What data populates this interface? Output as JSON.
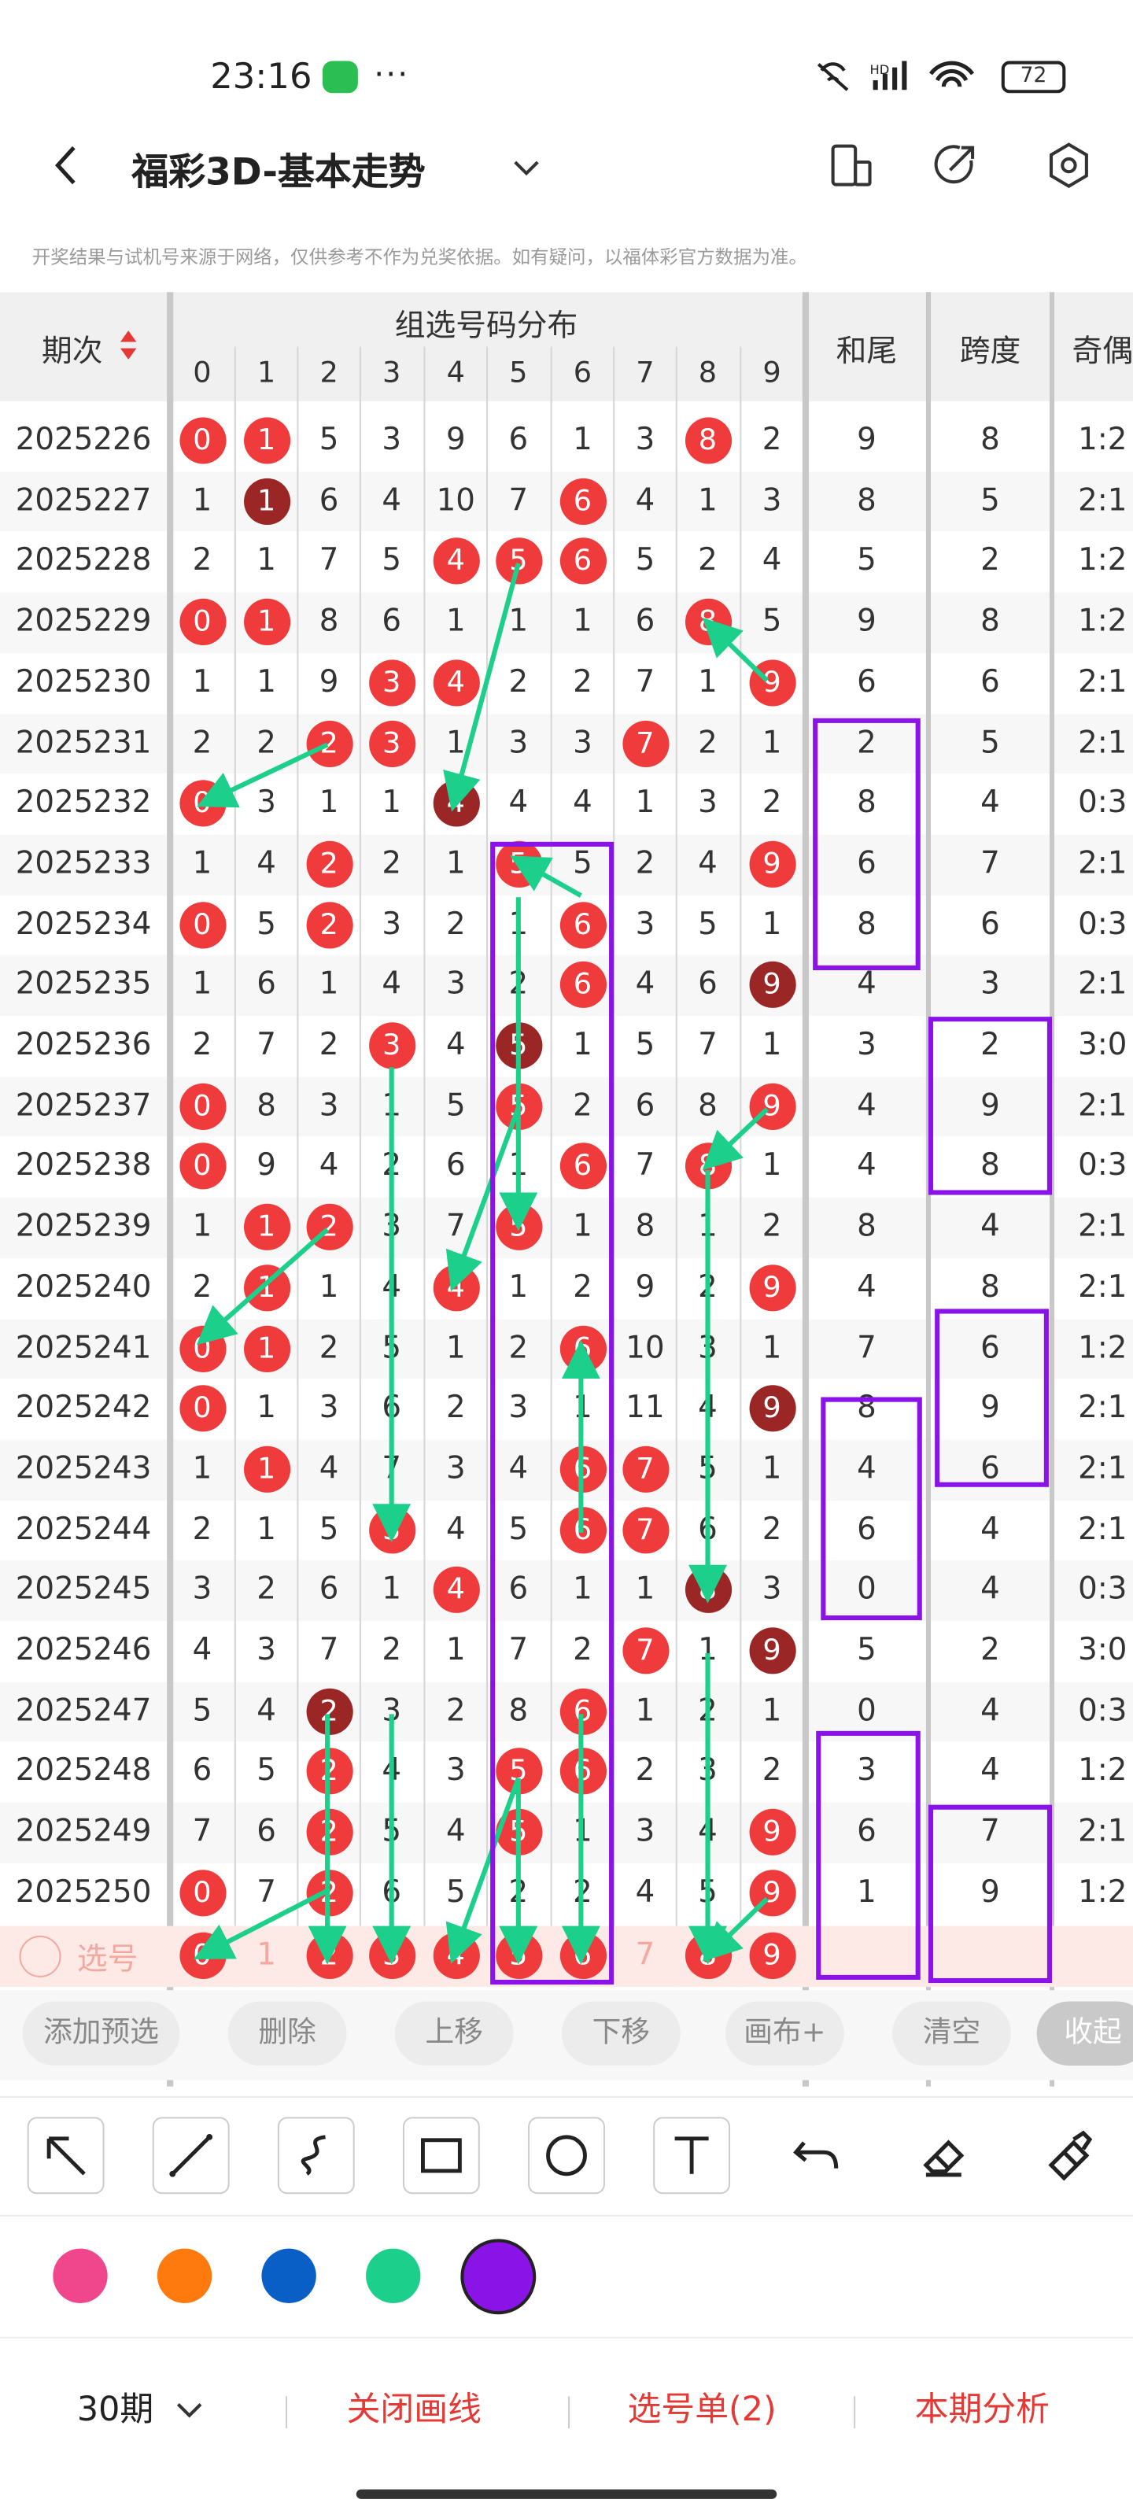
{
  "status_bar": {
    "time": "23:16",
    "more": "···",
    "signal": "HD",
    "battery": "72"
  },
  "nav": {
    "title": "福彩3D-基本走势",
    "back_icon": "chevron-left-icon",
    "dropdown_icon": "chevron-down-icon"
  },
  "notice": "开奖结果与试机号来源于网络，仅供参考不作为兑奖依据。如有疑问，以福体彩官方数据为准。",
  "table": {
    "col_period": "期次",
    "group_header": "组选号码分布",
    "digits": [
      "0",
      "1",
      "2",
      "3",
      "4",
      "5",
      "6",
      "7",
      "8",
      "9"
    ],
    "col_sum_tail": "和尾",
    "col_span": "跨度",
    "col_odd_even": "奇偶",
    "rows": [
      {
        "period": "2025226",
        "cells": [
          "0",
          "1",
          "5",
          "3",
          "9",
          "6",
          "1",
          "3",
          "8",
          "2"
        ],
        "hits": [
          0,
          1,
          8
        ],
        "dark": [],
        "sum_tail": "9",
        "span": "8",
        "odd_even": "1:2"
      },
      {
        "period": "2025227",
        "cells": [
          "1",
          "1",
          "6",
          "4",
          "10",
          "7",
          "6",
          "4",
          "1",
          "3"
        ],
        "hits": [
          1,
          6
        ],
        "dark": [
          1
        ],
        "sum_tail": "8",
        "span": "5",
        "odd_even": "2:1"
      },
      {
        "period": "2025228",
        "cells": [
          "2",
          "1",
          "7",
          "5",
          "4",
          "5",
          "6",
          "5",
          "2",
          "4"
        ],
        "hits": [
          4,
          5,
          6
        ],
        "dark": [],
        "sum_tail": "5",
        "span": "2",
        "odd_even": "1:2"
      },
      {
        "period": "2025229",
        "cells": [
          "0",
          "1",
          "8",
          "6",
          "1",
          "1",
          "1",
          "6",
          "8",
          "5"
        ],
        "hits": [
          0,
          1,
          8
        ],
        "dark": [],
        "sum_tail": "9",
        "span": "8",
        "odd_even": "1:2"
      },
      {
        "period": "2025230",
        "cells": [
          "1",
          "1",
          "9",
          "3",
          "4",
          "2",
          "2",
          "7",
          "1",
          "9"
        ],
        "hits": [
          3,
          4,
          9
        ],
        "dark": [],
        "sum_tail": "6",
        "span": "6",
        "odd_even": "2:1"
      },
      {
        "period": "2025231",
        "cells": [
          "2",
          "2",
          "2",
          "3",
          "1",
          "3",
          "3",
          "7",
          "2",
          "1"
        ],
        "hits": [
          2,
          3,
          7
        ],
        "dark": [],
        "sum_tail": "2",
        "span": "5",
        "odd_even": "2:1"
      },
      {
        "period": "2025232",
        "cells": [
          "0",
          "3",
          "1",
          "1",
          "4",
          "4",
          "4",
          "1",
          "3",
          "2"
        ],
        "hits": [
          0,
          4
        ],
        "dark": [
          4
        ],
        "sum_tail": "8",
        "span": "4",
        "odd_even": "0:3"
      },
      {
        "period": "2025233",
        "cells": [
          "1",
          "4",
          "2",
          "2",
          "1",
          "5",
          "5",
          "2",
          "4",
          "9"
        ],
        "hits": [
          2,
          5,
          9
        ],
        "dark": [],
        "sum_tail": "6",
        "span": "7",
        "odd_even": "2:1"
      },
      {
        "period": "2025234",
        "cells": [
          "0",
          "5",
          "2",
          "3",
          "2",
          "1",
          "6",
          "3",
          "5",
          "1"
        ],
        "hits": [
          0,
          2,
          6
        ],
        "dark": [],
        "sum_tail": "8",
        "span": "6",
        "odd_even": "0:3"
      },
      {
        "period": "2025235",
        "cells": [
          "1",
          "6",
          "1",
          "4",
          "3",
          "2",
          "6",
          "4",
          "6",
          "9"
        ],
        "hits": [
          6,
          9
        ],
        "dark": [
          9
        ],
        "sum_tail": "4",
        "span": "3",
        "odd_even": "2:1"
      },
      {
        "period": "2025236",
        "cells": [
          "2",
          "7",
          "2",
          "3",
          "4",
          "5",
          "1",
          "5",
          "7",
          "1"
        ],
        "hits": [
          3,
          5
        ],
        "dark": [
          5
        ],
        "sum_tail": "3",
        "span": "2",
        "odd_even": "3:0"
      },
      {
        "period": "2025237",
        "cells": [
          "0",
          "8",
          "3",
          "1",
          "5",
          "5",
          "2",
          "6",
          "8",
          "9"
        ],
        "hits": [
          0,
          5,
          9
        ],
        "dark": [],
        "sum_tail": "4",
        "span": "9",
        "odd_even": "2:1"
      },
      {
        "period": "2025238",
        "cells": [
          "0",
          "9",
          "4",
          "2",
          "6",
          "1",
          "6",
          "7",
          "8",
          "1"
        ],
        "hits": [
          0,
          6,
          8
        ],
        "dark": [],
        "sum_tail": "4",
        "span": "8",
        "odd_even": "0:3"
      },
      {
        "period": "2025239",
        "cells": [
          "1",
          "1",
          "2",
          "3",
          "7",
          "5",
          "1",
          "8",
          "1",
          "2"
        ],
        "hits": [
          1,
          2,
          5
        ],
        "dark": [],
        "sum_tail": "8",
        "span": "4",
        "odd_even": "2:1"
      },
      {
        "period": "2025240",
        "cells": [
          "2",
          "1",
          "1",
          "4",
          "4",
          "1",
          "2",
          "9",
          "2",
          "9"
        ],
        "hits": [
          1,
          4,
          9
        ],
        "dark": [],
        "sum_tail": "4",
        "span": "8",
        "odd_even": "2:1"
      },
      {
        "period": "2025241",
        "cells": [
          "0",
          "1",
          "2",
          "5",
          "1",
          "2",
          "6",
          "10",
          "3",
          "1"
        ],
        "hits": [
          0,
          1,
          6
        ],
        "dark": [],
        "sum_tail": "7",
        "span": "6",
        "odd_even": "1:2"
      },
      {
        "period": "2025242",
        "cells": [
          "0",
          "1",
          "3",
          "6",
          "2",
          "3",
          "1",
          "11",
          "4",
          "9"
        ],
        "hits": [
          0,
          9
        ],
        "dark": [
          9
        ],
        "sum_tail": "8",
        "span": "9",
        "odd_even": "2:1"
      },
      {
        "period": "2025243",
        "cells": [
          "1",
          "1",
          "4",
          "7",
          "3",
          "4",
          "6",
          "7",
          "5",
          "1"
        ],
        "hits": [
          1,
          6,
          7
        ],
        "dark": [],
        "sum_tail": "4",
        "span": "6",
        "odd_even": "2:1"
      },
      {
        "period": "2025244",
        "cells": [
          "2",
          "1",
          "5",
          "3",
          "4",
          "5",
          "6",
          "7",
          "6",
          "2"
        ],
        "hits": [
          3,
          6,
          7
        ],
        "dark": [],
        "sum_tail": "6",
        "span": "4",
        "odd_even": "2:1"
      },
      {
        "period": "2025245",
        "cells": [
          "3",
          "2",
          "6",
          "1",
          "4",
          "6",
          "1",
          "1",
          "8",
          "3"
        ],
        "hits": [
          4,
          8
        ],
        "dark": [
          8
        ],
        "sum_tail": "0",
        "span": "4",
        "odd_even": "0:3"
      },
      {
        "period": "2025246",
        "cells": [
          "4",
          "3",
          "7",
          "2",
          "1",
          "7",
          "2",
          "7",
          "1",
          "9"
        ],
        "hits": [
          7,
          9
        ],
        "dark": [
          9
        ],
        "sum_tail": "5",
        "span": "2",
        "odd_even": "3:0"
      },
      {
        "period": "2025247",
        "cells": [
          "5",
          "4",
          "2",
          "3",
          "2",
          "8",
          "6",
          "1",
          "2",
          "1"
        ],
        "hits": [
          2,
          6
        ],
        "dark": [
          2
        ],
        "sum_tail": "0",
        "span": "4",
        "odd_even": "0:3"
      },
      {
        "period": "2025248",
        "cells": [
          "6",
          "5",
          "2",
          "4",
          "3",
          "5",
          "6",
          "2",
          "3",
          "2"
        ],
        "hits": [
          2,
          5,
          6
        ],
        "dark": [],
        "sum_tail": "3",
        "span": "4",
        "odd_even": "1:2"
      },
      {
        "period": "2025249",
        "cells": [
          "7",
          "6",
          "2",
          "5",
          "4",
          "5",
          "1",
          "3",
          "4",
          "9"
        ],
        "hits": [
          2,
          5,
          9
        ],
        "dark": [],
        "sum_tail": "6",
        "span": "7",
        "odd_even": "2:1"
      },
      {
        "period": "2025250",
        "cells": [
          "0",
          "7",
          "2",
          "6",
          "5",
          "2",
          "2",
          "4",
          "5",
          "9"
        ],
        "hits": [
          0,
          2,
          9
        ],
        "dark": [],
        "sum_tail": "1",
        "span": "9",
        "odd_even": "1:2"
      }
    ],
    "pick_row": {
      "label": "选号",
      "cells": [
        "0",
        "1",
        "2",
        "3",
        "4",
        "5",
        "6",
        "7",
        "8",
        "9"
      ],
      "selected": [
        0,
        2,
        3,
        4,
        5,
        6,
        8,
        9
      ]
    }
  },
  "toolbar": {
    "add": "添加预选",
    "delete": "删除",
    "up": "上移",
    "down": "下移",
    "canvas": "画布+",
    "clear": "清空",
    "collapse": "收起"
  },
  "draw_tools": [
    "arrow-tool-icon",
    "line-tool-icon",
    "curve-tool-icon",
    "rectangle-tool-icon",
    "circle-tool-icon",
    "text-tool-icon",
    "undo-icon",
    "eraser-icon",
    "clear-drawing-icon"
  ],
  "colors": [
    "#f0478c",
    "#ff7a0e",
    "#0a5fc7",
    "#1ccf8a",
    "#8a14e8"
  ],
  "bottom": {
    "periods": "30期",
    "close_lines": "关闭画线",
    "pick_list": "选号单(2)",
    "analysis": "本期分析"
  }
}
